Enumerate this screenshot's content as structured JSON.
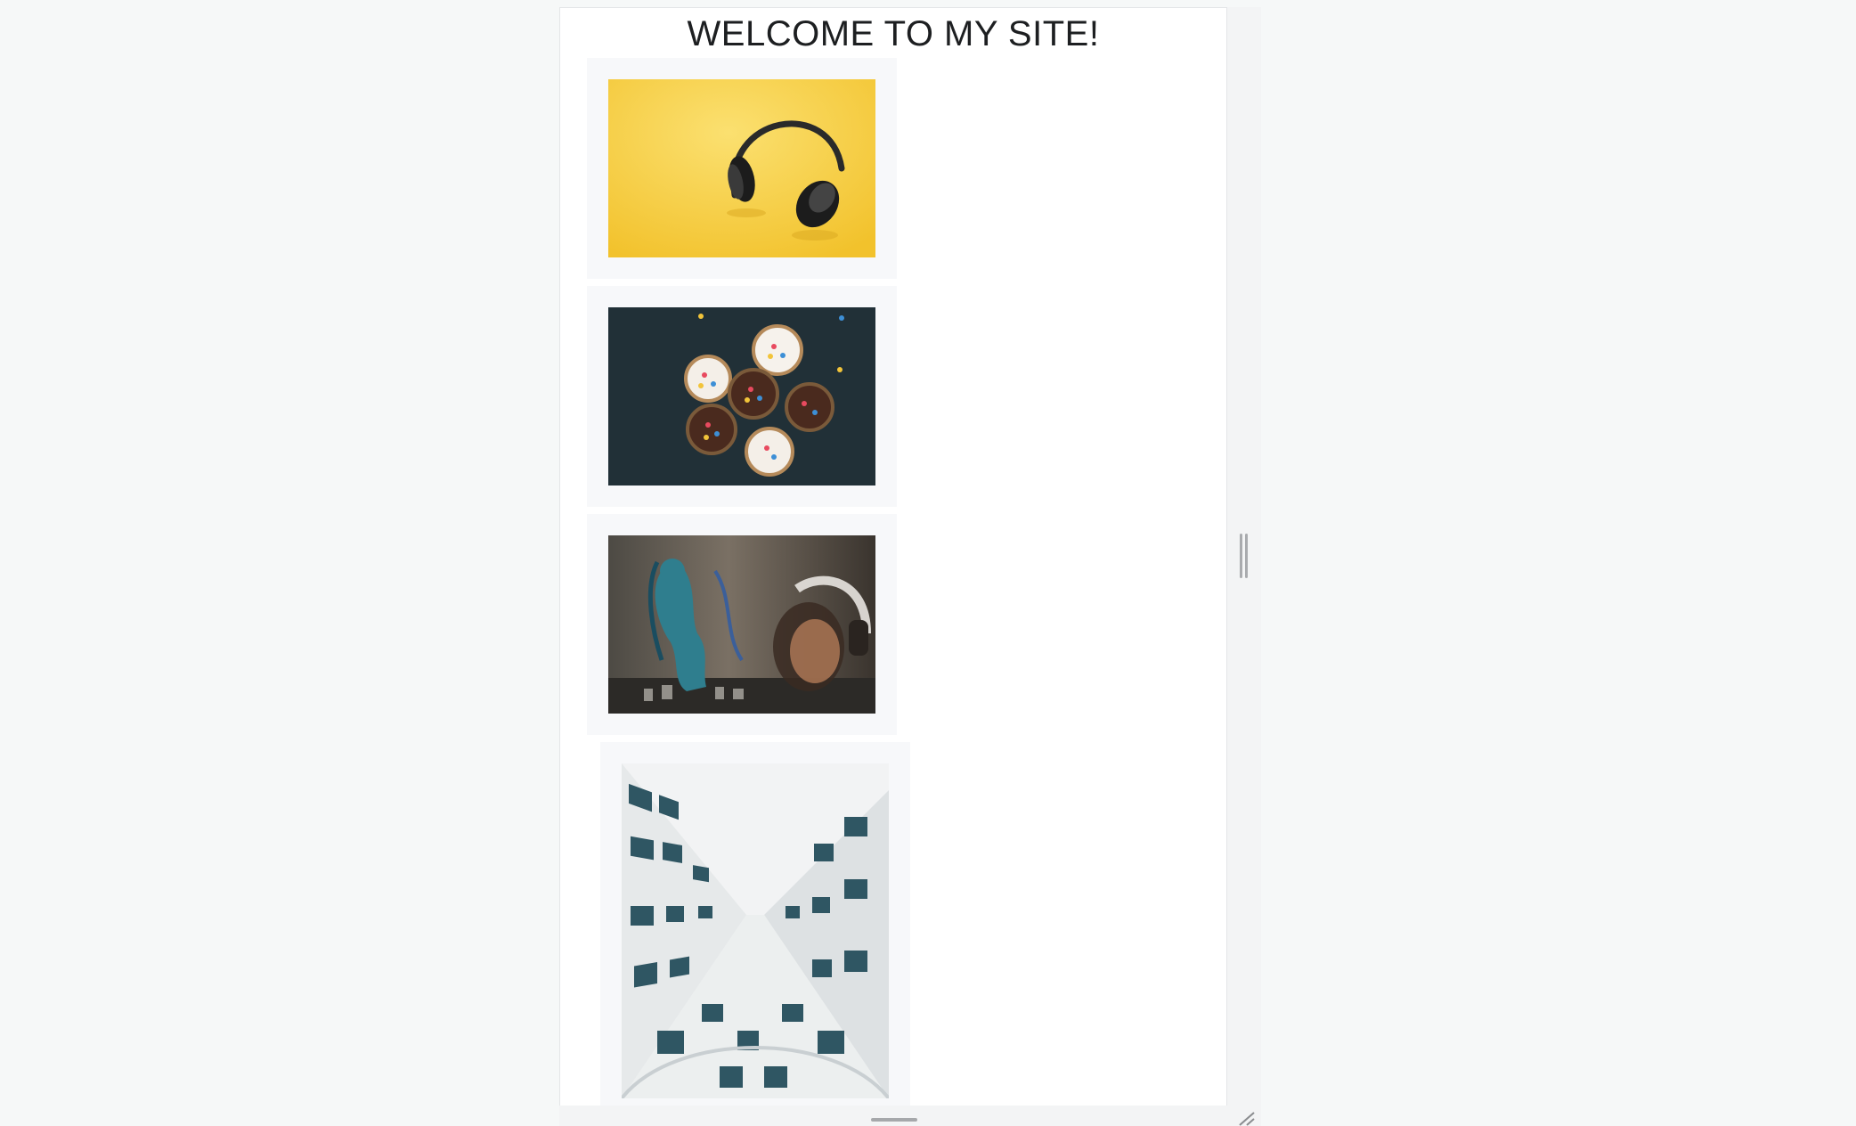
{
  "page": {
    "title": "WELCOME TO MY SITE!"
  },
  "gallery": {
    "images": [
      {
        "subject": "headphones-on-yellow-background"
      },
      {
        "subject": "cupcakes-on-dark-wood"
      },
      {
        "subject": "graffiti-wall-with-person-wearing-headphones"
      },
      {
        "subject": "building-facade-looking-up"
      }
    ]
  },
  "colors": {
    "page_background": "#ffffff",
    "card_background": "#f7f8fa",
    "title_text": "#1d1f21",
    "outer_background": "#f6f8f8"
  },
  "icons": {
    "side_resize": "vertical-grip-icon",
    "bottom_resize": "horizontal-grip-icon",
    "corner_resize": "resize-corner-icon"
  }
}
